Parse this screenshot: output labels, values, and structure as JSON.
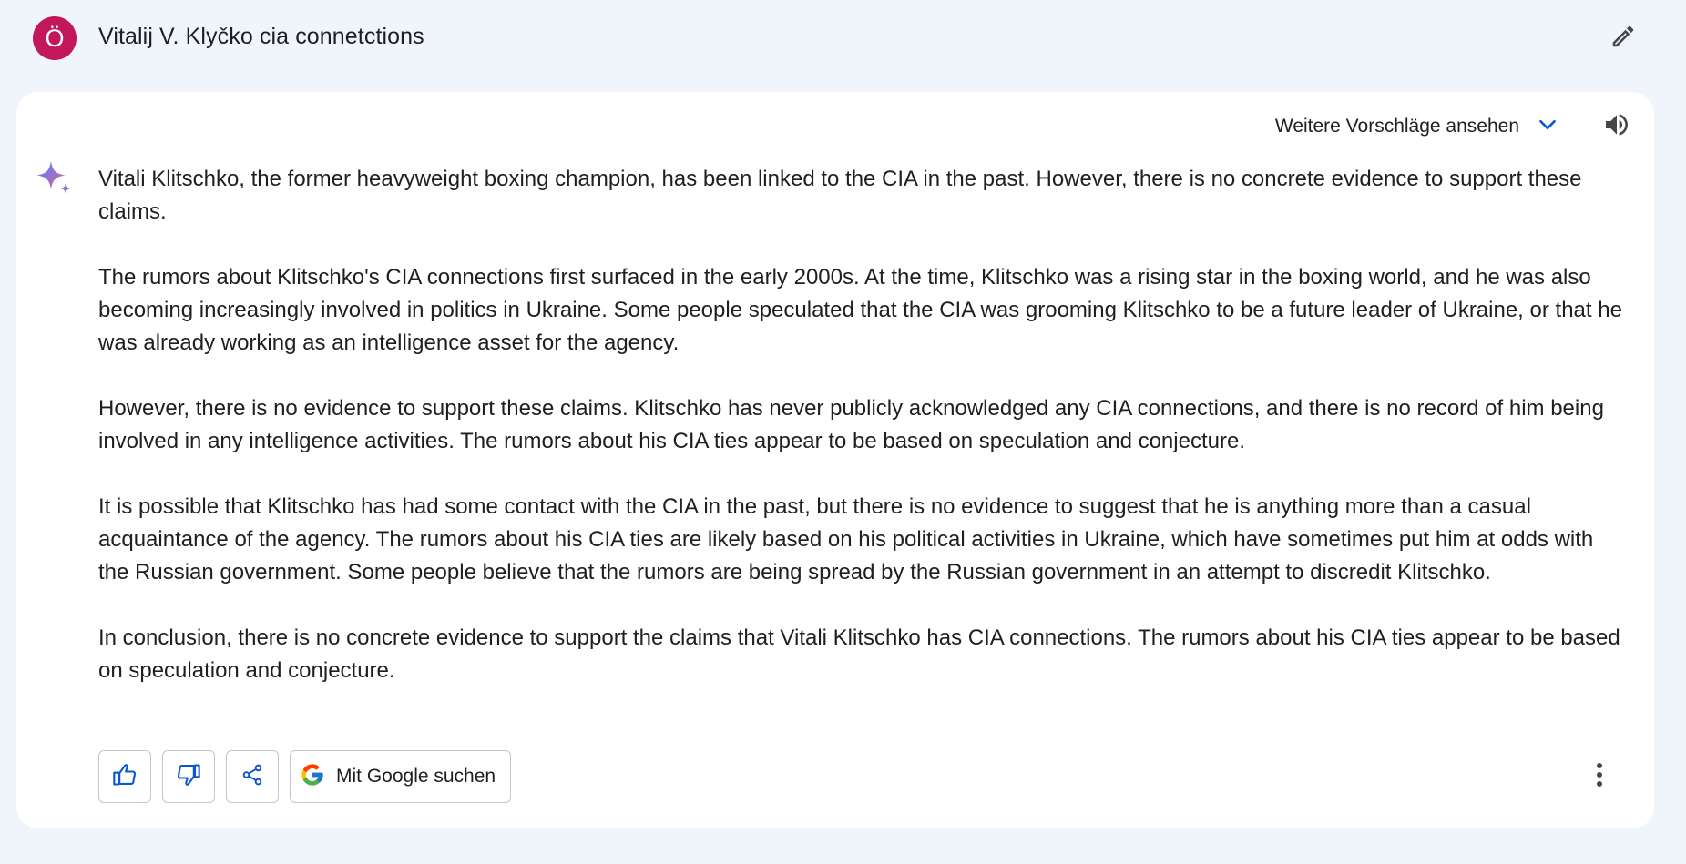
{
  "user": {
    "avatar_letter": "Ö",
    "avatar_color": "#c2185b"
  },
  "prompt": {
    "text": "Vitalij V. Klyčko cia connetctions",
    "edit_icon": "pencil-icon"
  },
  "response_header": {
    "suggestions_label": "Weitere Vorschläge ansehen",
    "suggestions_icon": "chevron-down-icon",
    "speaker_icon": "speaker-icon",
    "accent_color": "#0b57d0"
  },
  "response": {
    "model_icon": "gemini-spark-icon",
    "paragraphs": [
      "Vitali Klitschko, the former heavyweight boxing champion, has been linked to the CIA in the past. However, there is no concrete evidence to support these claims.",
      "The rumors about Klitschko's CIA connections first surfaced in the early 2000s. At the time, Klitschko was a rising star in the boxing world, and he was also becoming increasingly involved in politics in Ukraine. Some people speculated that the CIA was grooming Klitschko to be a future leader of Ukraine, or that he was already working as an intelligence asset for the agency.",
      "However, there is no evidence to support these claims. Klitschko has never publicly acknowledged any CIA connections, and there is no record of him being involved in any intelligence activities. The rumors about his CIA ties appear to be based on speculation and conjecture.",
      "It is possible that Klitschko has had some contact with the CIA in the past, but there is no evidence to suggest that he is anything more than a casual acquaintance of the agency. The rumors about his CIA ties are likely based on his political activities in Ukraine, which have sometimes put him at odds with the Russian government. Some people believe that the rumors are being spread by the Russian government in an attempt to discredit Klitschko.",
      "In conclusion, there is no concrete evidence to support the claims that Vitali Klitschko has CIA connections. The rumors about his CIA ties appear to be based on speculation and conjecture."
    ]
  },
  "actions": {
    "thumbs_up_icon": "thumbs-up-icon",
    "thumbs_down_icon": "thumbs-down-icon",
    "share_icon": "share-icon",
    "google_icon": "google-g-icon",
    "google_search_label": "Mit Google suchen",
    "more_icon": "more-vert-icon"
  }
}
